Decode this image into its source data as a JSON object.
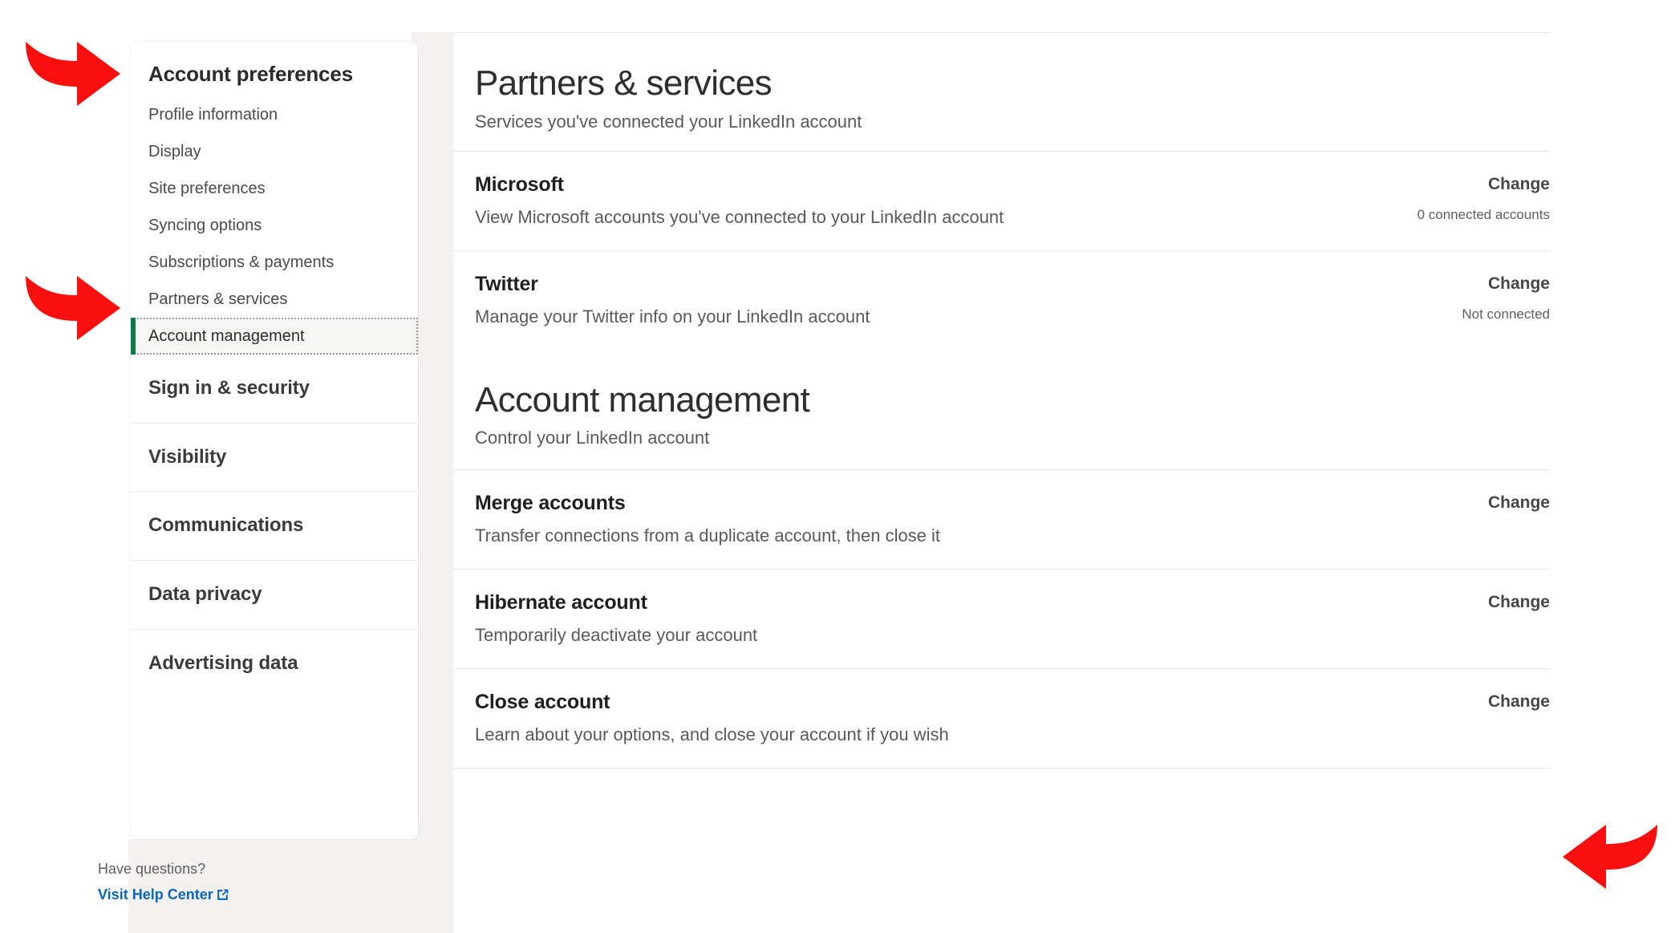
{
  "sidebar": {
    "groups": [
      {
        "header": "Account preferences",
        "items": [
          {
            "label": "Profile information",
            "selected": false
          },
          {
            "label": "Display",
            "selected": false
          },
          {
            "label": "Site preferences",
            "selected": false
          },
          {
            "label": "Syncing options",
            "selected": false
          },
          {
            "label": "Subscriptions & payments",
            "selected": false
          },
          {
            "label": "Partners & services",
            "selected": false
          },
          {
            "label": "Account management",
            "selected": true
          }
        ]
      },
      {
        "major": "Sign in & security"
      },
      {
        "major": "Visibility"
      },
      {
        "major": "Communications"
      },
      {
        "major": "Data privacy"
      },
      {
        "major": "Advertising data"
      }
    ],
    "footer": {
      "question": "Have questions?",
      "help_link": "Visit Help Center",
      "external_icon": "external-link-icon"
    },
    "selected_accent_color": "#0a7b45"
  },
  "main": {
    "sections": [
      {
        "title": "Partners & services",
        "subtitle": "Services you've connected your LinkedIn account",
        "rows": [
          {
            "title": "Microsoft",
            "desc": "View Microsoft accounts you've connected to your LinkedIn account",
            "action": "Change",
            "status": "0 connected accounts"
          },
          {
            "title": "Twitter",
            "desc": "Manage your Twitter info on your LinkedIn account",
            "action": "Change",
            "status": "Not connected"
          }
        ]
      },
      {
        "title": "Account management",
        "subtitle": "Control your LinkedIn account",
        "rows": [
          {
            "title": "Merge accounts",
            "desc": "Transfer connections from a duplicate account, then close it",
            "action": "Change",
            "status": ""
          },
          {
            "title": "Hibernate account",
            "desc": "Temporarily deactivate your account",
            "action": "Change",
            "status": ""
          },
          {
            "title": "Close account",
            "desc": "Learn about your options, and close your account if you wish",
            "action": "Change",
            "status": ""
          }
        ]
      }
    ]
  },
  "annotations": {
    "arrows": [
      {
        "name": "arrow-pointing-account-preferences",
        "direction": "right",
        "color": "#fa0f0f"
      },
      {
        "name": "arrow-pointing-account-management",
        "direction": "right",
        "color": "#fa0f0f"
      },
      {
        "name": "arrow-pointing-close-account-change",
        "direction": "left",
        "color": "#fa0f0f"
      }
    ]
  }
}
